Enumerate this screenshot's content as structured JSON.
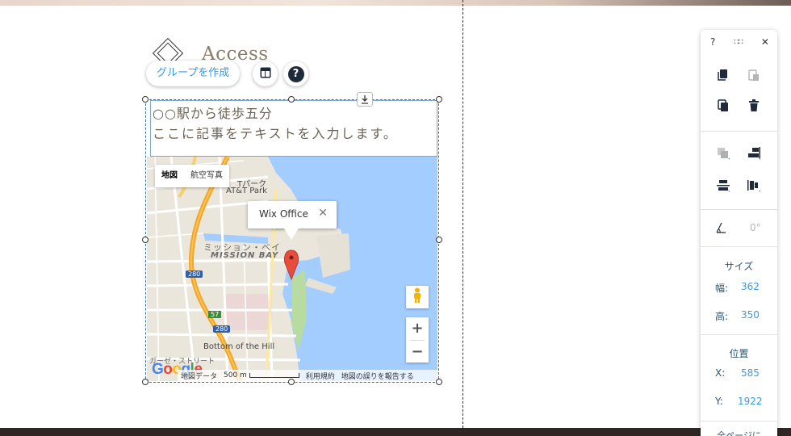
{
  "page": {
    "heading": "Access"
  },
  "toolbar": {
    "group_label": "グループを作成"
  },
  "textbox": {
    "line1": "○○駅から徒歩五分",
    "line2": "ここに記事をテキストを入力します。"
  },
  "map": {
    "type_map": "地図",
    "type_satellite": "航空写真",
    "infowindow_title": "Wix Office",
    "infowindow_close": "✕",
    "labels": {
      "park_top": "Tパーク",
      "att_park": "AT&T Park",
      "mission_bay_jp": "ミッション・ベイ",
      "mission_bay": "MISSION BAY",
      "hwy_280a": "280",
      "hwy_280b": "280",
      "hwy_57": "57",
      "bottom_of_hill": "Bottom of the Hill",
      "street_jp1": "ガーゼ・ストリート",
      "street_jp2": "ストリー"
    },
    "google": "Google",
    "footer": {
      "data": "地図データ",
      "scale": "500 m",
      "terms": "利用規約",
      "report": "地図の誤りを報告する"
    },
    "zoom_in": "+",
    "zoom_out": "−"
  },
  "panel": {
    "help": "?",
    "drag": "∷∷",
    "close": "✕",
    "size_heading": "サイズ",
    "width_label": "幅:",
    "width_value": "362",
    "height_label": "高:",
    "height_value": "350",
    "position_heading": "位置",
    "x_label": "X:",
    "x_value": "585",
    "y_label": "Y:",
    "y_value": "1922",
    "rotation_value": "0°",
    "bottom_cut": "全ページに"
  },
  "colors": {
    "accent": "#3899ec",
    "panel_text": "#2b5672",
    "water": "#a3ccff",
    "pin": "#e74c3c"
  }
}
